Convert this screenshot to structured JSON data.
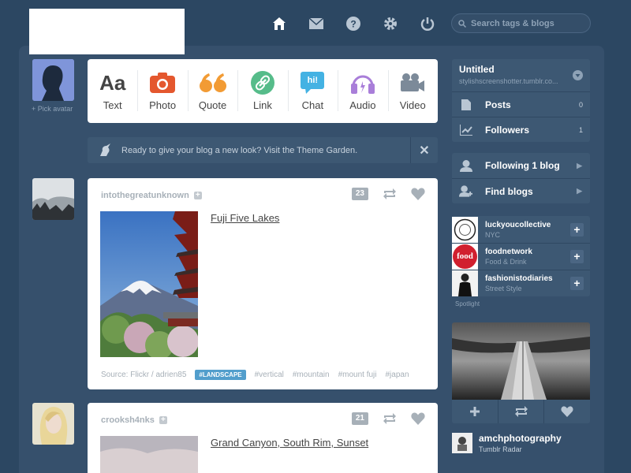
{
  "nav": {
    "search_placeholder": "Search tags & blogs"
  },
  "me": {
    "pick_avatar": "+ Pick avatar"
  },
  "post_types": [
    {
      "label": "Text",
      "glyph": "Aa"
    },
    {
      "label": "Photo"
    },
    {
      "label": "Quote"
    },
    {
      "label": "Link"
    },
    {
      "label": "Chat",
      "glyph": "hi!"
    },
    {
      "label": "Audio"
    },
    {
      "label": "Video"
    }
  ],
  "notice": {
    "text": "Ready to give your blog a new look? Visit the Theme Garden.",
    "close": "✕"
  },
  "posts": [
    {
      "author": "intothegreatunknown",
      "notes": "23",
      "title": "Fuji Five Lakes",
      "source": "Source: Flickr / adrien85",
      "featured_tag": "#LANDSCAPE",
      "tags": [
        "#vertical",
        "#mountain",
        "#mount fuji",
        "#japan"
      ]
    },
    {
      "author": "crooksh4nks",
      "notes": "21",
      "title": "Grand Canyon, South Rim, Sunset"
    }
  ],
  "sidebar": {
    "blog": {
      "title": "Untitled",
      "url": "stylishscreenshotter.tumblr.co..."
    },
    "stats": [
      {
        "label": "Posts",
        "count": "0"
      },
      {
        "label": "Followers",
        "count": "1"
      }
    ],
    "links": [
      {
        "label": "Following 1 blog"
      },
      {
        "label": "Find blogs"
      }
    ],
    "recommended": [
      {
        "name": "luckyoucollective",
        "sub": "NYC"
      },
      {
        "name": "foodnetwork",
        "sub": "Food & Drink",
        "logo_text": "food"
      },
      {
        "name": "fashionistodiaries",
        "sub": "Street Style"
      }
    ],
    "spotlight": "Spotlight",
    "radar": {
      "name": "amchphotography",
      "sub": "Tumblr Radar"
    }
  },
  "colors": {
    "background": "#2c4762",
    "photo": "#e4572e",
    "quote": "#f29b34",
    "link": "#56bc8a",
    "chat": "#44b2e3",
    "audio": "#a97ed9",
    "video": "#7c8a99",
    "tag_blue": "#529ecc"
  }
}
